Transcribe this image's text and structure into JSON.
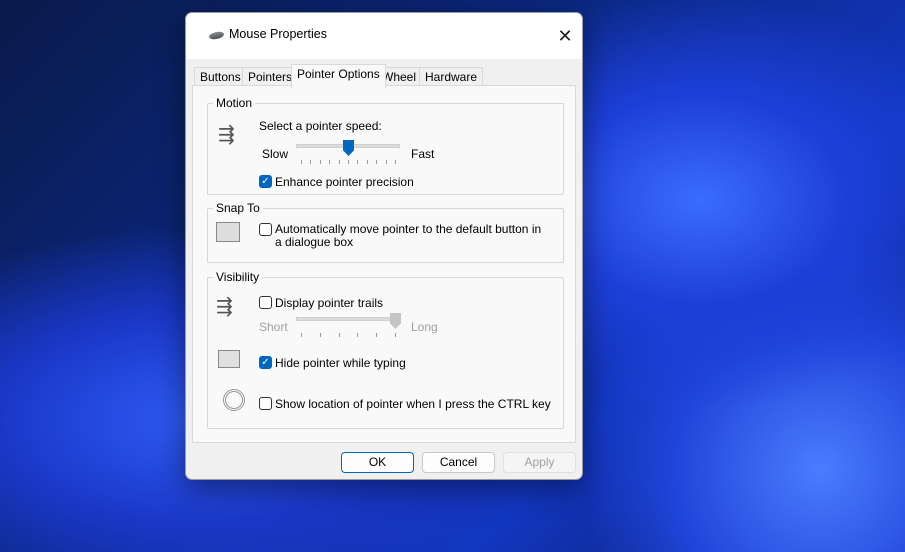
{
  "window": {
    "title": "Mouse Properties",
    "close_icon": "close-icon"
  },
  "tabs": [
    {
      "label": "Buttons"
    },
    {
      "label": "Pointers"
    },
    {
      "label": "Pointer Options",
      "active": true
    },
    {
      "label": "Wheel"
    },
    {
      "label": "Hardware"
    }
  ],
  "motion": {
    "group_label": "Motion",
    "speed_label": "Select a pointer speed:",
    "slow": "Slow",
    "fast": "Fast",
    "speed_value": 6,
    "speed_max": 11,
    "enhance_label": "Enhance pointer precision",
    "enhance_checked": true
  },
  "snap": {
    "group_label": "Snap To",
    "label": "Automatically move pointer to the default button in a dialogue box",
    "checked": false
  },
  "visibility": {
    "group_label": "Visibility",
    "trails_label": "Display pointer trails",
    "trails_checked": false,
    "short": "Short",
    "long": "Long",
    "trails_value": 6,
    "trails_max": 6,
    "hide_label": "Hide pointer while typing",
    "hide_checked": true,
    "show_label": "Show location of pointer when I press the CTRL key",
    "show_checked": false
  },
  "buttons": {
    "ok": "OK",
    "cancel": "Cancel",
    "apply": "Apply"
  },
  "colors": {
    "accent": "#0067c0"
  }
}
